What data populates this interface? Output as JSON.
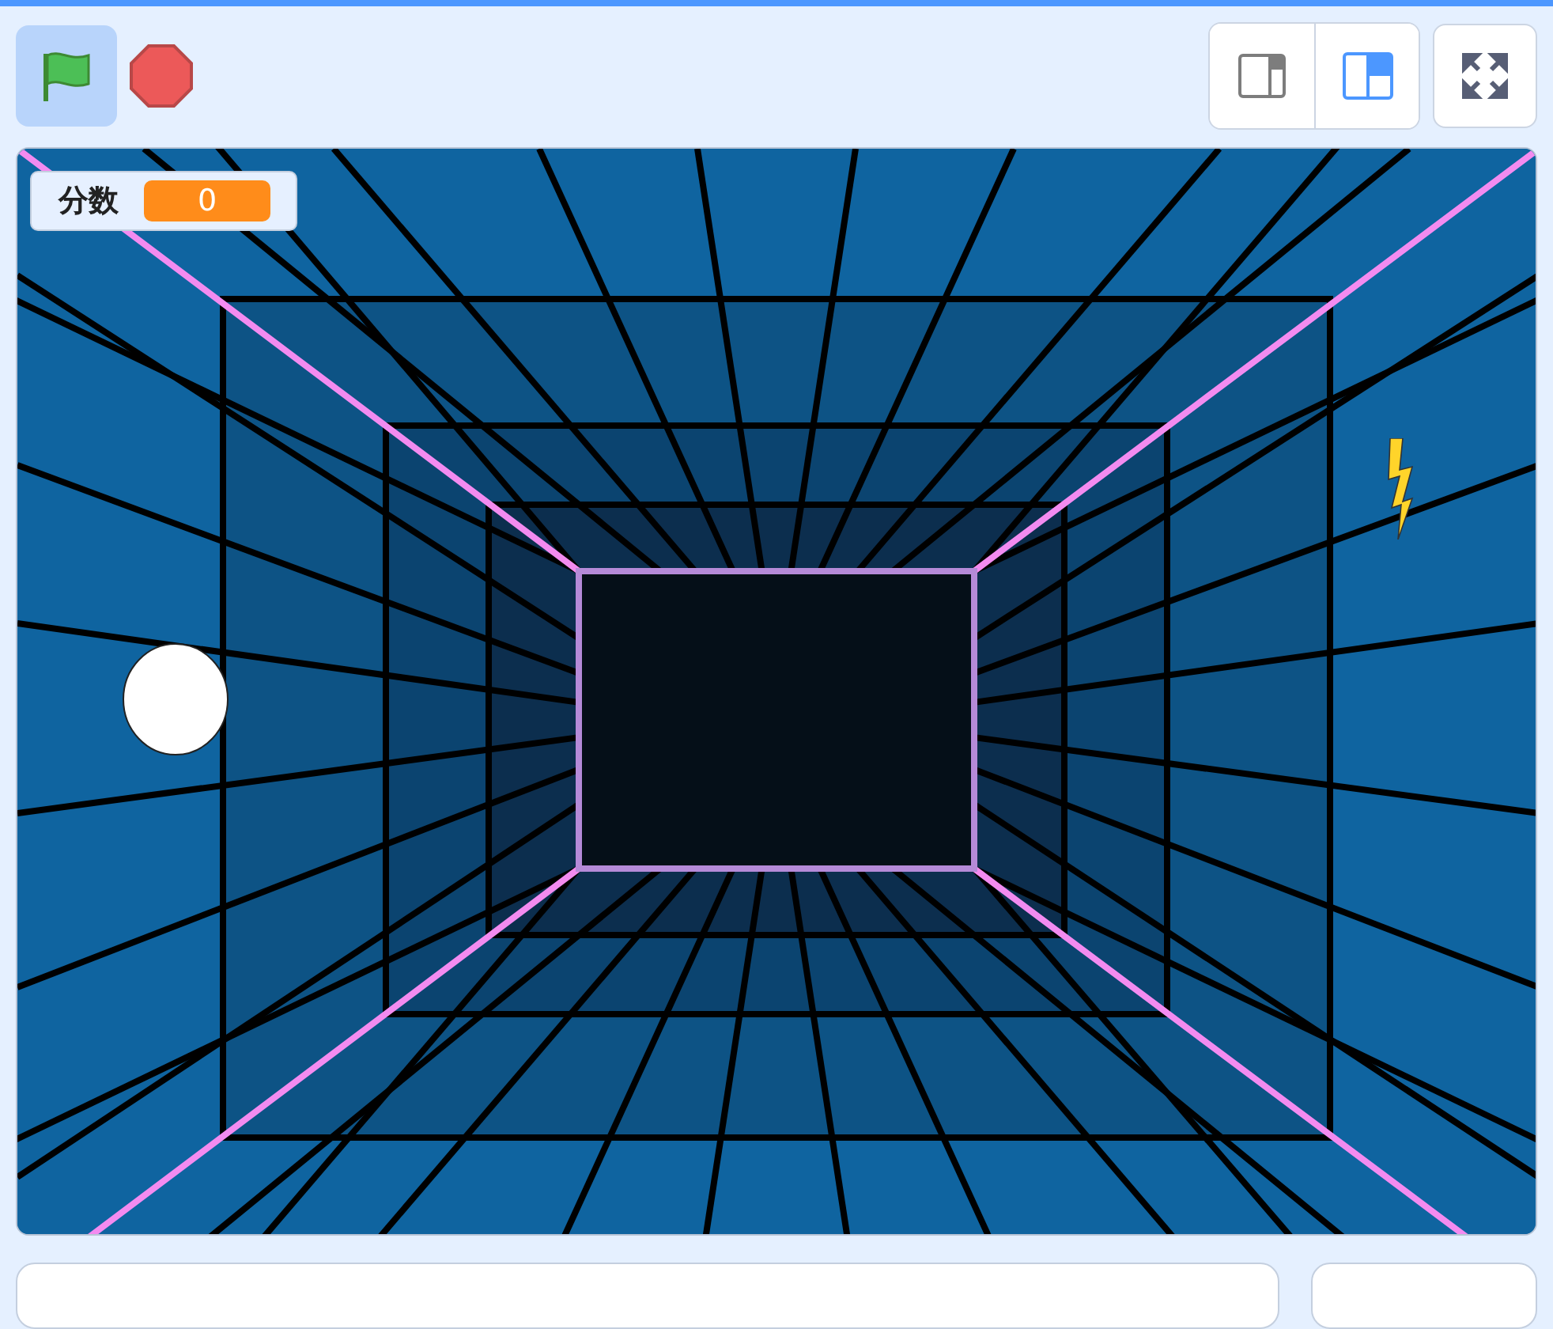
{
  "toolbar": {
    "buttons": [
      {
        "kind": "flag",
        "selected": true
      },
      {
        "kind": "stop",
        "selected": false
      }
    ],
    "layout_modes": [
      {
        "kind": "small",
        "selected": false
      },
      {
        "kind": "normal",
        "selected": true
      }
    ]
  },
  "stage": {
    "monitor": {
      "label": "分数",
      "value": "0"
    }
  }
}
